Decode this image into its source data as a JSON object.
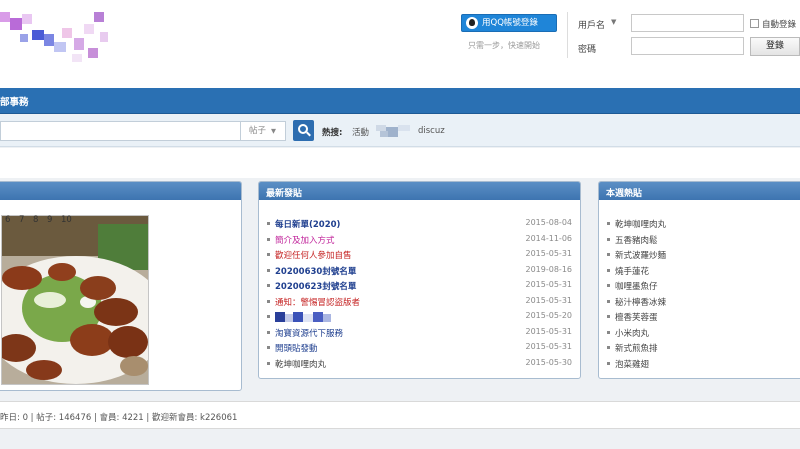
{
  "header": {
    "qq_login_label": "用QQ帳號登錄",
    "qq_subtext": "只需一步，快速開始",
    "username_label": "用戶名",
    "password_label": "密碼",
    "auto_login_label": "自動登錄",
    "login_button": "登錄"
  },
  "nav": {
    "items": [
      "部事務"
    ]
  },
  "search": {
    "type_value": "帖子",
    "hot_label": "熱搜:",
    "hot_terms": [
      "活動",
      "discuz"
    ]
  },
  "panels": {
    "slideshow": {
      "numbers": [
        "6",
        "7",
        "8",
        "9",
        "10"
      ]
    },
    "latest": {
      "title": "最新發貼",
      "rows": [
        {
          "title": "每日新單(2020)",
          "date": "2015-08-04",
          "color": "#1f3f8f",
          "bold": true
        },
        {
          "title": "簡介及加入方式",
          "date": "2014-11-06",
          "color": "#c0229a",
          "bold": false
        },
        {
          "title": "歡迎任何人參加自售",
          "date": "2015-05-31",
          "color": "#c41f1f",
          "bold": false
        },
        {
          "title": "20200630封號名單",
          "date": "2019-08-16",
          "color": "#1f3f8f",
          "bold": true
        },
        {
          "title": "20200623封號名單",
          "date": "2015-05-31",
          "color": "#1f3f8f",
          "bold": true
        },
        {
          "title": "通知：警惕冒認盜版者",
          "date": "2015-05-31",
          "color": "#c41f1f",
          "bold": false
        },
        {
          "title": "",
          "date": "2015-05-20",
          "color": "#1f3f8f",
          "bold": false
        },
        {
          "title": "淘寶資源代下服務",
          "date": "2015-05-31",
          "color": "#1f3f8f",
          "bold": false
        },
        {
          "title": "開頭貼發動",
          "date": "2015-05-31",
          "color": "#1f3f8f",
          "bold": false
        },
        {
          "title": "乾坤咖哩肉丸",
          "date": "2015-05-30",
          "color": "#444444",
          "bold": false
        }
      ]
    },
    "weekly_hot": {
      "title": "本週熱貼",
      "rows": [
        "乾坤咖哩肉丸",
        "五香豬肉鬆",
        "新式波羅炒麵",
        "燒手蓮花",
        "咖哩墨魚仔",
        "秘汁檸香冰辣",
        "檀香芙蓉蛋",
        "小米肉丸",
        "新式煎魚排",
        "泡菜雞翅"
      ]
    }
  },
  "stats": {
    "text": "昨日: 0  |  帖子: 146476  |  會員: 4221  |  歡迎新會員: k226061"
  }
}
